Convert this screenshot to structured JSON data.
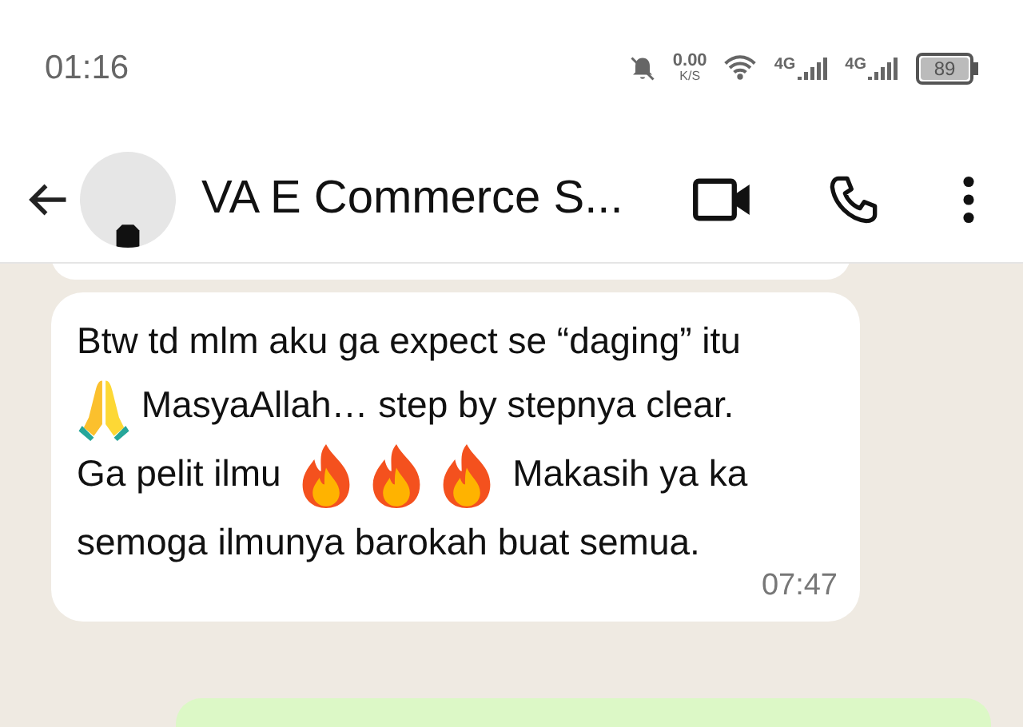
{
  "status_bar": {
    "time": "01:16",
    "speed_value": "0.00",
    "speed_unit": "K/S",
    "networks": [
      {
        "label": "4G"
      },
      {
        "label": "4G"
      }
    ],
    "battery": "89"
  },
  "header": {
    "title": "VA E Commerce S..."
  },
  "message": {
    "time": "07:47",
    "parts": [
      {
        "kind": "text",
        "text": "Btw td mlm aku ga expect se “daging” itu "
      },
      {
        "kind": "pray"
      },
      {
        "kind": "text",
        "text": " MasyaAllah… step by stepnya clear. Ga pelit ilmu "
      },
      {
        "kind": "fire"
      },
      {
        "kind": "fire"
      },
      {
        "kind": "fire"
      },
      {
        "kind": "text",
        "text": " Makasih ya ka semoga ilmunya barokah buat semua."
      }
    ]
  }
}
